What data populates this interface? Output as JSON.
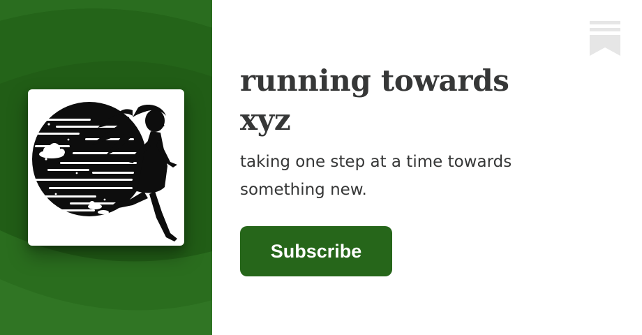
{
  "publication": {
    "title": "running towards xyz",
    "description": "taking one step at a time towards something new."
  },
  "actions": {
    "subscribe_label": "Subscribe"
  },
  "icons": {
    "bookmark": "bookmark-icon",
    "logo": "running-girl-logo"
  },
  "colors": {
    "brand_green": "#26661a",
    "text": "#363737",
    "bookmark_gray": "#e6e6e6"
  }
}
